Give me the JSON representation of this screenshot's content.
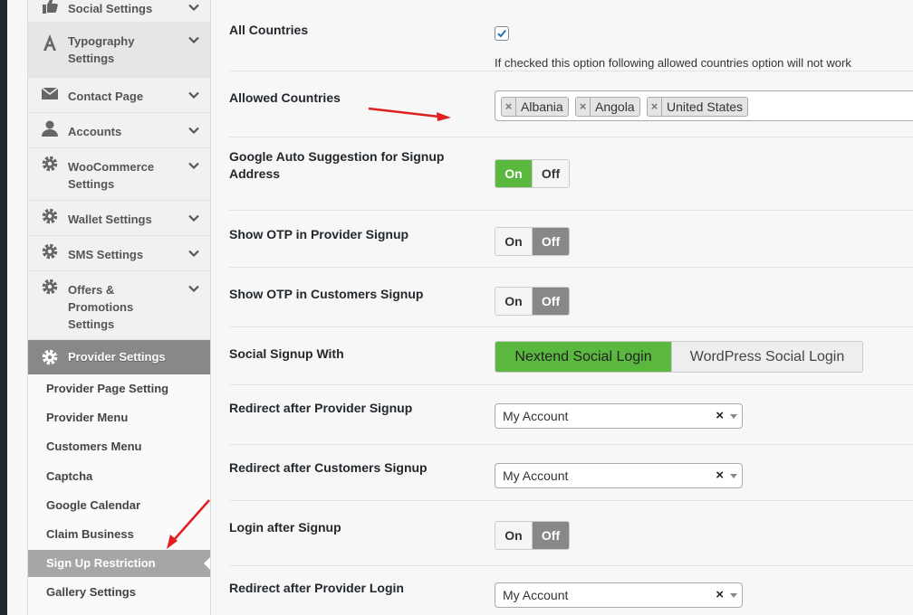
{
  "sidebar": {
    "items": [
      {
        "label": "Social Settings",
        "icon": "thumbs-up-icon"
      },
      {
        "label": "Typography Settings",
        "icon": "font-a-icon"
      },
      {
        "label": "Contact Page",
        "icon": "envelope-icon"
      },
      {
        "label": "Accounts",
        "icon": "user-icon"
      },
      {
        "label": "WooCommerce Settings",
        "icon": "gear-icon"
      },
      {
        "label": "Wallet Settings",
        "icon": "gear-icon"
      },
      {
        "label": "SMS Settings",
        "icon": "gear-icon"
      },
      {
        "label": "Offers & Promotions Settings",
        "icon": "gear-icon"
      }
    ],
    "active_section": {
      "label": "Provider Settings",
      "icon": "gear-icon"
    },
    "subitems": [
      {
        "label": "Provider Page Setting"
      },
      {
        "label": "Provider Menu"
      },
      {
        "label": "Customers Menu"
      },
      {
        "label": "Captcha"
      },
      {
        "label": "Google Calendar"
      },
      {
        "label": "Claim Business"
      },
      {
        "label": "Sign Up Restriction",
        "current": true
      },
      {
        "label": "Gallery Settings"
      }
    ]
  },
  "settings": {
    "all_countries": {
      "label": "All Countries",
      "checked": true,
      "help": "If checked this option following allowed countries option will not work"
    },
    "allowed_countries": {
      "label": "Allowed Countries",
      "chips": [
        "Albania",
        "Angola",
        "United States"
      ]
    },
    "google_auto": {
      "label": "Google Auto Suggestion for Signup Address",
      "on": "On",
      "off": "Off",
      "value": "On"
    },
    "otp_provider": {
      "label": "Show OTP in Provider Signup",
      "on": "On",
      "off": "Off",
      "value": "Off"
    },
    "otp_customers": {
      "label": "Show OTP in Customers Signup",
      "on": "On",
      "off": "Off",
      "value": "Off"
    },
    "social_signup": {
      "label": "Social Signup With",
      "options": [
        "Nextend Social Login",
        "WordPress Social Login"
      ],
      "value": "Nextend Social Login"
    },
    "redirect_provider_signup": {
      "label": "Redirect after Provider Signup",
      "value": "My Account"
    },
    "redirect_customers_signup": {
      "label": "Redirect after Customers Signup",
      "value": "My Account"
    },
    "login_after_signup": {
      "label": "Login after Signup",
      "on": "On",
      "off": "Off",
      "value": "Off"
    },
    "redirect_provider_login": {
      "label": "Redirect after Provider Login",
      "value": "My Account"
    }
  },
  "colors": {
    "green": "#5bb83e",
    "grey_selected": "#888888",
    "annotation_red": "#e02020"
  }
}
